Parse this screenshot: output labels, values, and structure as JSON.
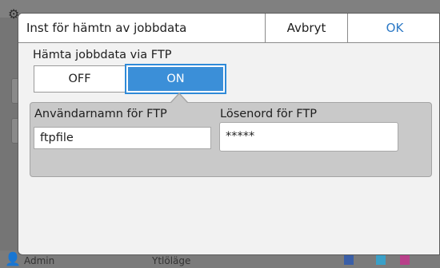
{
  "dialog": {
    "title": "Inst för hämtn av jobbdata",
    "cancel_label": "Avbryt",
    "ok_label": "OK"
  },
  "ftp_toggle": {
    "label": "Hämta jobbdata via FTP",
    "off_label": "OFF",
    "on_label": "ON",
    "selected": "ON"
  },
  "ftp_settings": {
    "username_label": "Användarnamn för FTP",
    "username_value": "ftpfile",
    "password_label": "Lösenord för FTP",
    "password_value": "*****"
  },
  "background": {
    "user_label": "Admin",
    "status_label": "Ytlöläge"
  },
  "colors": {
    "accent": "#3b8fd8",
    "ok_text": "#2c79c6",
    "panel": "#c9c9c9"
  },
  "icons": [
    "gear-icon",
    "user-icon",
    "ink-level-icon"
  ]
}
